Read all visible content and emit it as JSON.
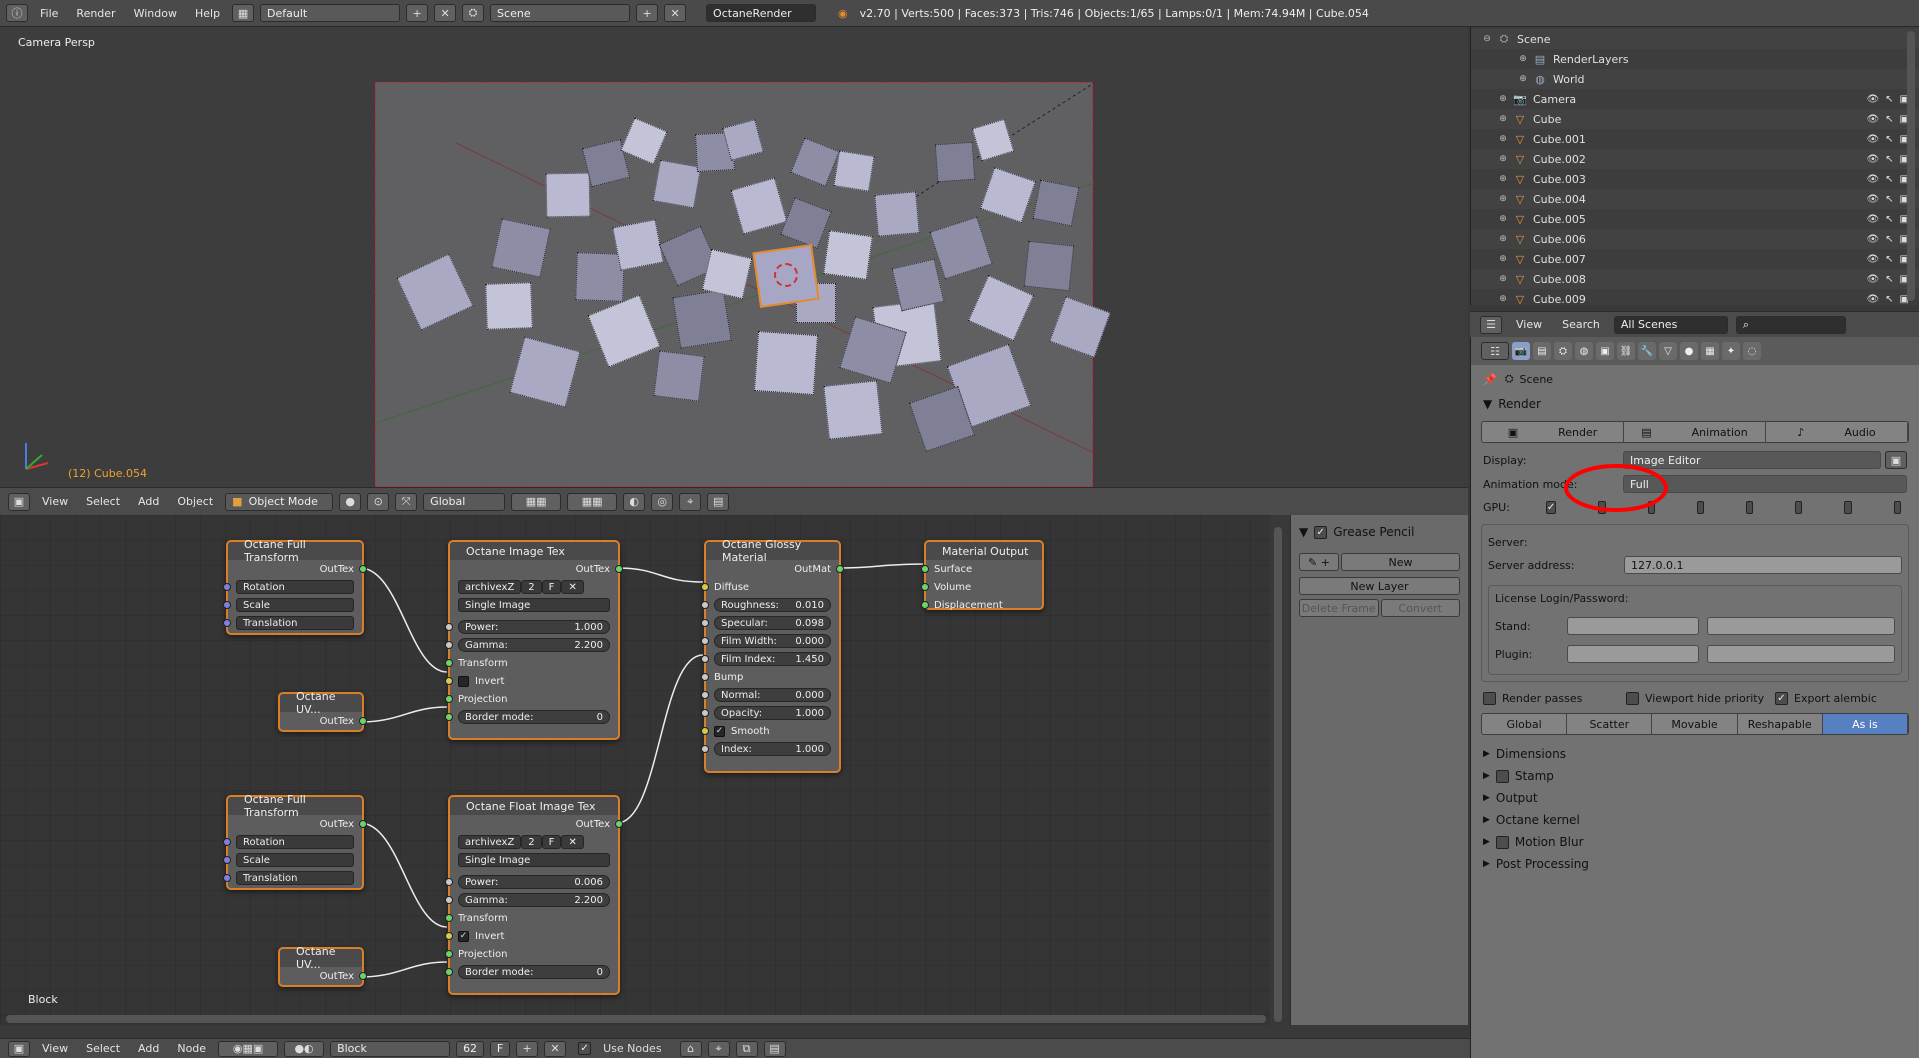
{
  "topbar": {
    "menus": [
      "File",
      "Render",
      "Window",
      "Help"
    ],
    "layout": "Default",
    "scene": "Scene",
    "engine": "OctaneRender",
    "stats": "v2.70 | Verts:500 | Faces:373 | Tris:746 | Objects:1/65 | Lamps:0/1 | Mem:74.94M | Cube.054"
  },
  "viewport": {
    "view_label": "Camera Persp",
    "object_label": "(12) Cube.054",
    "header": {
      "menus": [
        "View",
        "Select",
        "Add",
        "Object"
      ],
      "mode": "Object Mode",
      "orientation": "Global"
    }
  },
  "node_editor": {
    "nodes": {
      "full_transform_1": {
        "title": "Octane Full Transform",
        "out": "OutTex",
        "rows": [
          "Rotation",
          "Scale",
          "Translation"
        ]
      },
      "uv_1": {
        "title": "Octane UV...",
        "out": "OutTex"
      },
      "image_tex": {
        "title": "Octane Image Tex",
        "out": "OutTex",
        "image": "archivexZ",
        "frame": "2",
        "flag": "F",
        "mode": "Single Image",
        "power_label": "Power:",
        "power": "1.000",
        "gamma_label": "Gamma:",
        "gamma": "2.200",
        "transform": "Transform",
        "invert": "Invert",
        "projection": "Projection",
        "border_label": "Border mode:",
        "border": "0"
      },
      "glossy": {
        "title": "Octane Glossy Material",
        "out": "OutMat",
        "diffuse": "Diffuse",
        "roughness_label": "Roughness:",
        "roughness": "0.010",
        "specular_label": "Specular:",
        "specular": "0.098",
        "film_width_label": "Film Width:",
        "film_width": "0.000",
        "film_index_label": "Film Index:",
        "film_index": "1.450",
        "bump": "Bump",
        "normal_label": "Normal:",
        "normal": "0.000",
        "opacity_label": "Opacity:",
        "opacity": "1.000",
        "smooth": "Smooth",
        "index_label": "Index:",
        "index": "1.000"
      },
      "output": {
        "title": "Material Output",
        "rows": [
          "Surface",
          "Volume",
          "Displacement"
        ]
      },
      "full_transform_2": {
        "title": "Octane Full Transform",
        "out": "OutTex",
        "rows": [
          "Rotation",
          "Scale",
          "Translation"
        ]
      },
      "float_tex": {
        "title": "Octane Float Image Tex",
        "out": "OutTex",
        "image": "archivexZ",
        "frame": "2",
        "flag": "F",
        "mode": "Single Image",
        "power_label": "Power:",
        "power": "0.006",
        "gamma_label": "Gamma:",
        "gamma": "2.200",
        "transform": "Transform",
        "invert": "Invert",
        "projection": "Projection",
        "border_label": "Border mode:",
        "border": "0"
      },
      "uv_2": {
        "title": "Octane UV...",
        "out": "OutTex"
      }
    },
    "block_label": "Block"
  },
  "grease_pencil": {
    "title": "Grease Pencil",
    "new": "New",
    "new_layer": "New Layer",
    "delete_frame": "Delete Frame",
    "convert": "Convert"
  },
  "bottombar": {
    "menus": [
      "View",
      "Select",
      "Add",
      "Node"
    ],
    "block": "Block",
    "users": "62",
    "flag": "F",
    "use_nodes": "Use Nodes"
  },
  "outliner": {
    "items": [
      {
        "name": "Scene",
        "icon": "scene-icon"
      },
      {
        "name": "RenderLayers",
        "icon": "renderlayers-icon"
      },
      {
        "name": "World",
        "icon": "world-icon"
      },
      {
        "name": "Camera",
        "icon": "camera-icon"
      },
      {
        "name": "Cube",
        "icon": "mesh-icon"
      },
      {
        "name": "Cube.001",
        "icon": "mesh-icon"
      },
      {
        "name": "Cube.002",
        "icon": "mesh-icon"
      },
      {
        "name": "Cube.003",
        "icon": "mesh-icon"
      },
      {
        "name": "Cube.004",
        "icon": "mesh-icon"
      },
      {
        "name": "Cube.005",
        "icon": "mesh-icon"
      },
      {
        "name": "Cube.006",
        "icon": "mesh-icon"
      },
      {
        "name": "Cube.007",
        "icon": "mesh-icon"
      },
      {
        "name": "Cube.008",
        "icon": "mesh-icon"
      },
      {
        "name": "Cube.009",
        "icon": "mesh-icon"
      }
    ],
    "header": {
      "view": "View",
      "search": "Search",
      "filter": "All Scenes"
    }
  },
  "properties": {
    "context": "Scene",
    "render_panel": "Render",
    "render_buttons": [
      "Render",
      "Animation",
      "Audio"
    ],
    "display_label": "Display:",
    "display_value": "Image Editor",
    "anim_mode_label": "Animation mode:",
    "anim_mode_value": "Full",
    "gpu_label": "GPU:",
    "server_label": "Server:",
    "server_address_label": "Server address:",
    "server_address": "127.0.0.1",
    "license_label": "License Login/Password:",
    "stand_label": "Stand:",
    "plugin_label": "Plugin:",
    "render_passes": "Render passes",
    "viewport_hide": "Viewport hide priority",
    "export_alembic": "Export alembic",
    "export_modes": [
      "Global",
      "Scatter",
      "Movable",
      "Reshapable",
      "As is"
    ],
    "export_active": "As is",
    "collapsed_panels": [
      "Dimensions",
      "Stamp",
      "Output",
      "Octane kernel",
      "Motion Blur",
      "Post Processing"
    ]
  },
  "colors": {
    "node_border": "#d97f2a",
    "active_seg": "#5680c2",
    "annotation_circle": "#ff0000"
  }
}
